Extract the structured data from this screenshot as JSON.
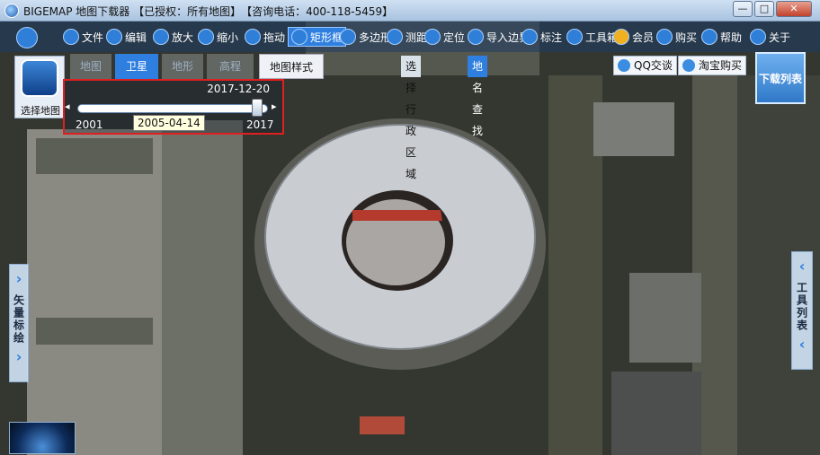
{
  "window": {
    "app_name": "BIGEMAP 地图下载器",
    "license": "【已授权：所有地图】",
    "phone": "【咨询电话：400-118-5459】",
    "controls": {
      "minimize": "—",
      "maximize": "□",
      "close": "✕"
    }
  },
  "toolbar": {
    "items": [
      {
        "label": "文件",
        "icon": "folder-icon"
      },
      {
        "label": "编辑",
        "icon": "edit-icon"
      },
      {
        "label": "放大",
        "icon": "zoom-in-icon"
      },
      {
        "label": "缩小",
        "icon": "zoom-out-icon"
      },
      {
        "label": "拖动",
        "icon": "hand-icon"
      },
      {
        "label": "矩形框",
        "icon": "rectangle-select-icon"
      },
      {
        "label": "多边形",
        "icon": "polygon-icon"
      },
      {
        "label": "测距",
        "icon": "ruler-icon"
      },
      {
        "label": "定位",
        "icon": "location-pin-icon"
      },
      {
        "label": "导入边界",
        "icon": "import-icon"
      },
      {
        "label": "标注",
        "icon": "marker-icon"
      },
      {
        "label": "工具箱",
        "icon": "toolbox-icon"
      },
      {
        "label": "会员",
        "icon": "vip-icon"
      },
      {
        "label": "购买",
        "icon": "cart-icon"
      },
      {
        "label": "帮助",
        "icon": "help-icon"
      },
      {
        "label": "关于",
        "icon": "info-icon"
      }
    ]
  },
  "map_selector": {
    "label": "选择地图"
  },
  "map_tabs": [
    {
      "label": "地图"
    },
    {
      "label": "卫星"
    },
    {
      "label": "地形"
    },
    {
      "label": "高程"
    }
  ],
  "map_style_label": "地图样式",
  "timeline": {
    "current_date": "2017-12-20",
    "start_year": "2001",
    "end_year": "2017",
    "hover_date": "2005-04-14"
  },
  "search": {
    "region_tab": "选择行政区域",
    "place_tab": "地名查找"
  },
  "contact": {
    "qq": "QQ交谈",
    "taobao": "淘宝购买"
  },
  "download_list": "下载列表",
  "left_panel": "矢量标绘",
  "right_panel": "工具列表"
}
